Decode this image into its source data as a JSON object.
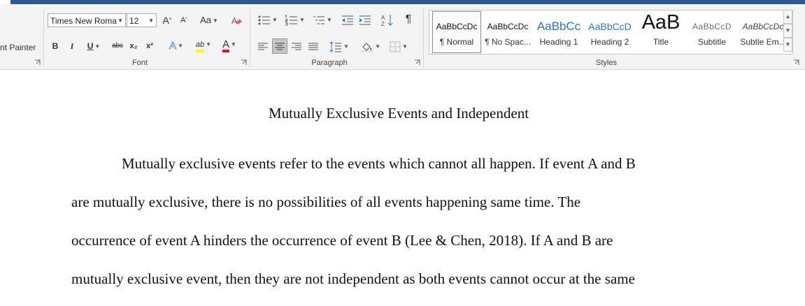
{
  "clipboard": {
    "format_painter_label": "nt Painter"
  },
  "font": {
    "font_name": "Times New Roma",
    "font_size": "12",
    "grow_label": "A",
    "shrink_label": "A",
    "case_label": "Aa",
    "bold_label": "B",
    "italic_label": "I",
    "underline_label": "U",
    "strike_label": "abc",
    "subscript_label": "x₂",
    "superscript_label": "x²",
    "effects_label": "A",
    "highlight_label": "ab",
    "font_color_label": "A",
    "group_label": "Font",
    "highlight_color": "#ffff00",
    "font_color": "#e81123"
  },
  "paragraph": {
    "show_marks_label": "¶",
    "group_label": "Paragraph"
  },
  "styles": {
    "group_label": "Styles",
    "items": [
      {
        "preview": "AaBbCcDc",
        "name": "¶ Normal"
      },
      {
        "preview": "AaBbCcDc",
        "name": "¶ No Spac..."
      },
      {
        "preview": "AaBbCc",
        "name": "Heading 1"
      },
      {
        "preview": "AaBbCcD",
        "name": "Heading 2"
      },
      {
        "preview": "AaB",
        "name": "Title"
      },
      {
        "preview": "AaBbCcD",
        "name": "Subtitle"
      },
      {
        "preview": "AaBbCcDc",
        "name": "Subtle Em..."
      }
    ]
  },
  "document": {
    "title": "Mutually Exclusive Events and Independent",
    "lines": [
      "Mutually exclusive events refer to the events which cannot all happen.  If event A and B",
      "are mutually exclusive, there is no possibilities of all events happening same time. The",
      "occurrence of event A hinders the occurrence of event B (Lee & Chen, 2018). If A and B are",
      "mutually exclusive event, then they are not independent as both events cannot occur at the same"
    ]
  },
  "colors": {
    "accent": "#2b579a",
    "heading_blue": "#2e74b5"
  }
}
